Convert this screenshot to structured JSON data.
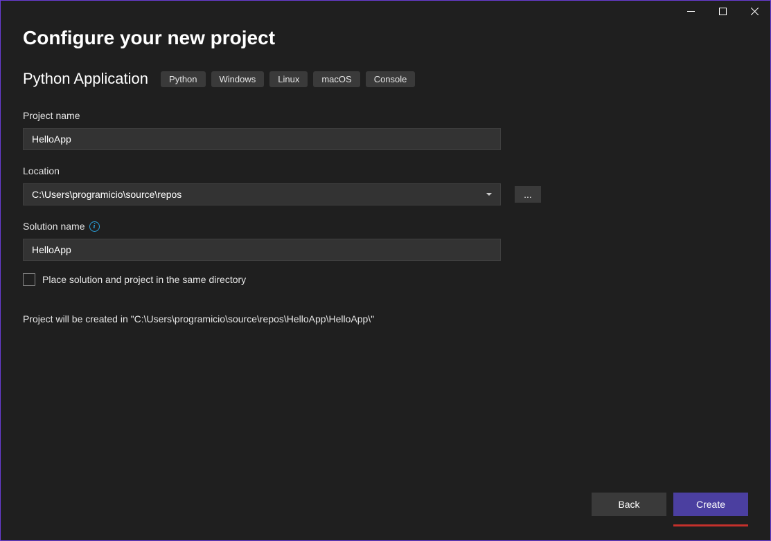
{
  "window": {
    "title": "Configure your new project"
  },
  "template": {
    "name": "Python Application",
    "tags": [
      "Python",
      "Windows",
      "Linux",
      "macOS",
      "Console"
    ]
  },
  "fields": {
    "project_name": {
      "label": "Project name",
      "value": "HelloApp"
    },
    "location": {
      "label": "Location",
      "value": "C:\\Users\\programicio\\source\\repos",
      "browse": "..."
    },
    "solution_name": {
      "label": "Solution name",
      "value": "HelloApp"
    },
    "same_dir": {
      "label": "Place solution and project in the same directory",
      "checked": false
    }
  },
  "summary": "Project will be created in \"C:\\Users\\programicio\\source\\repos\\HelloApp\\HelloApp\\\"",
  "buttons": {
    "back": "Back",
    "create": "Create"
  }
}
